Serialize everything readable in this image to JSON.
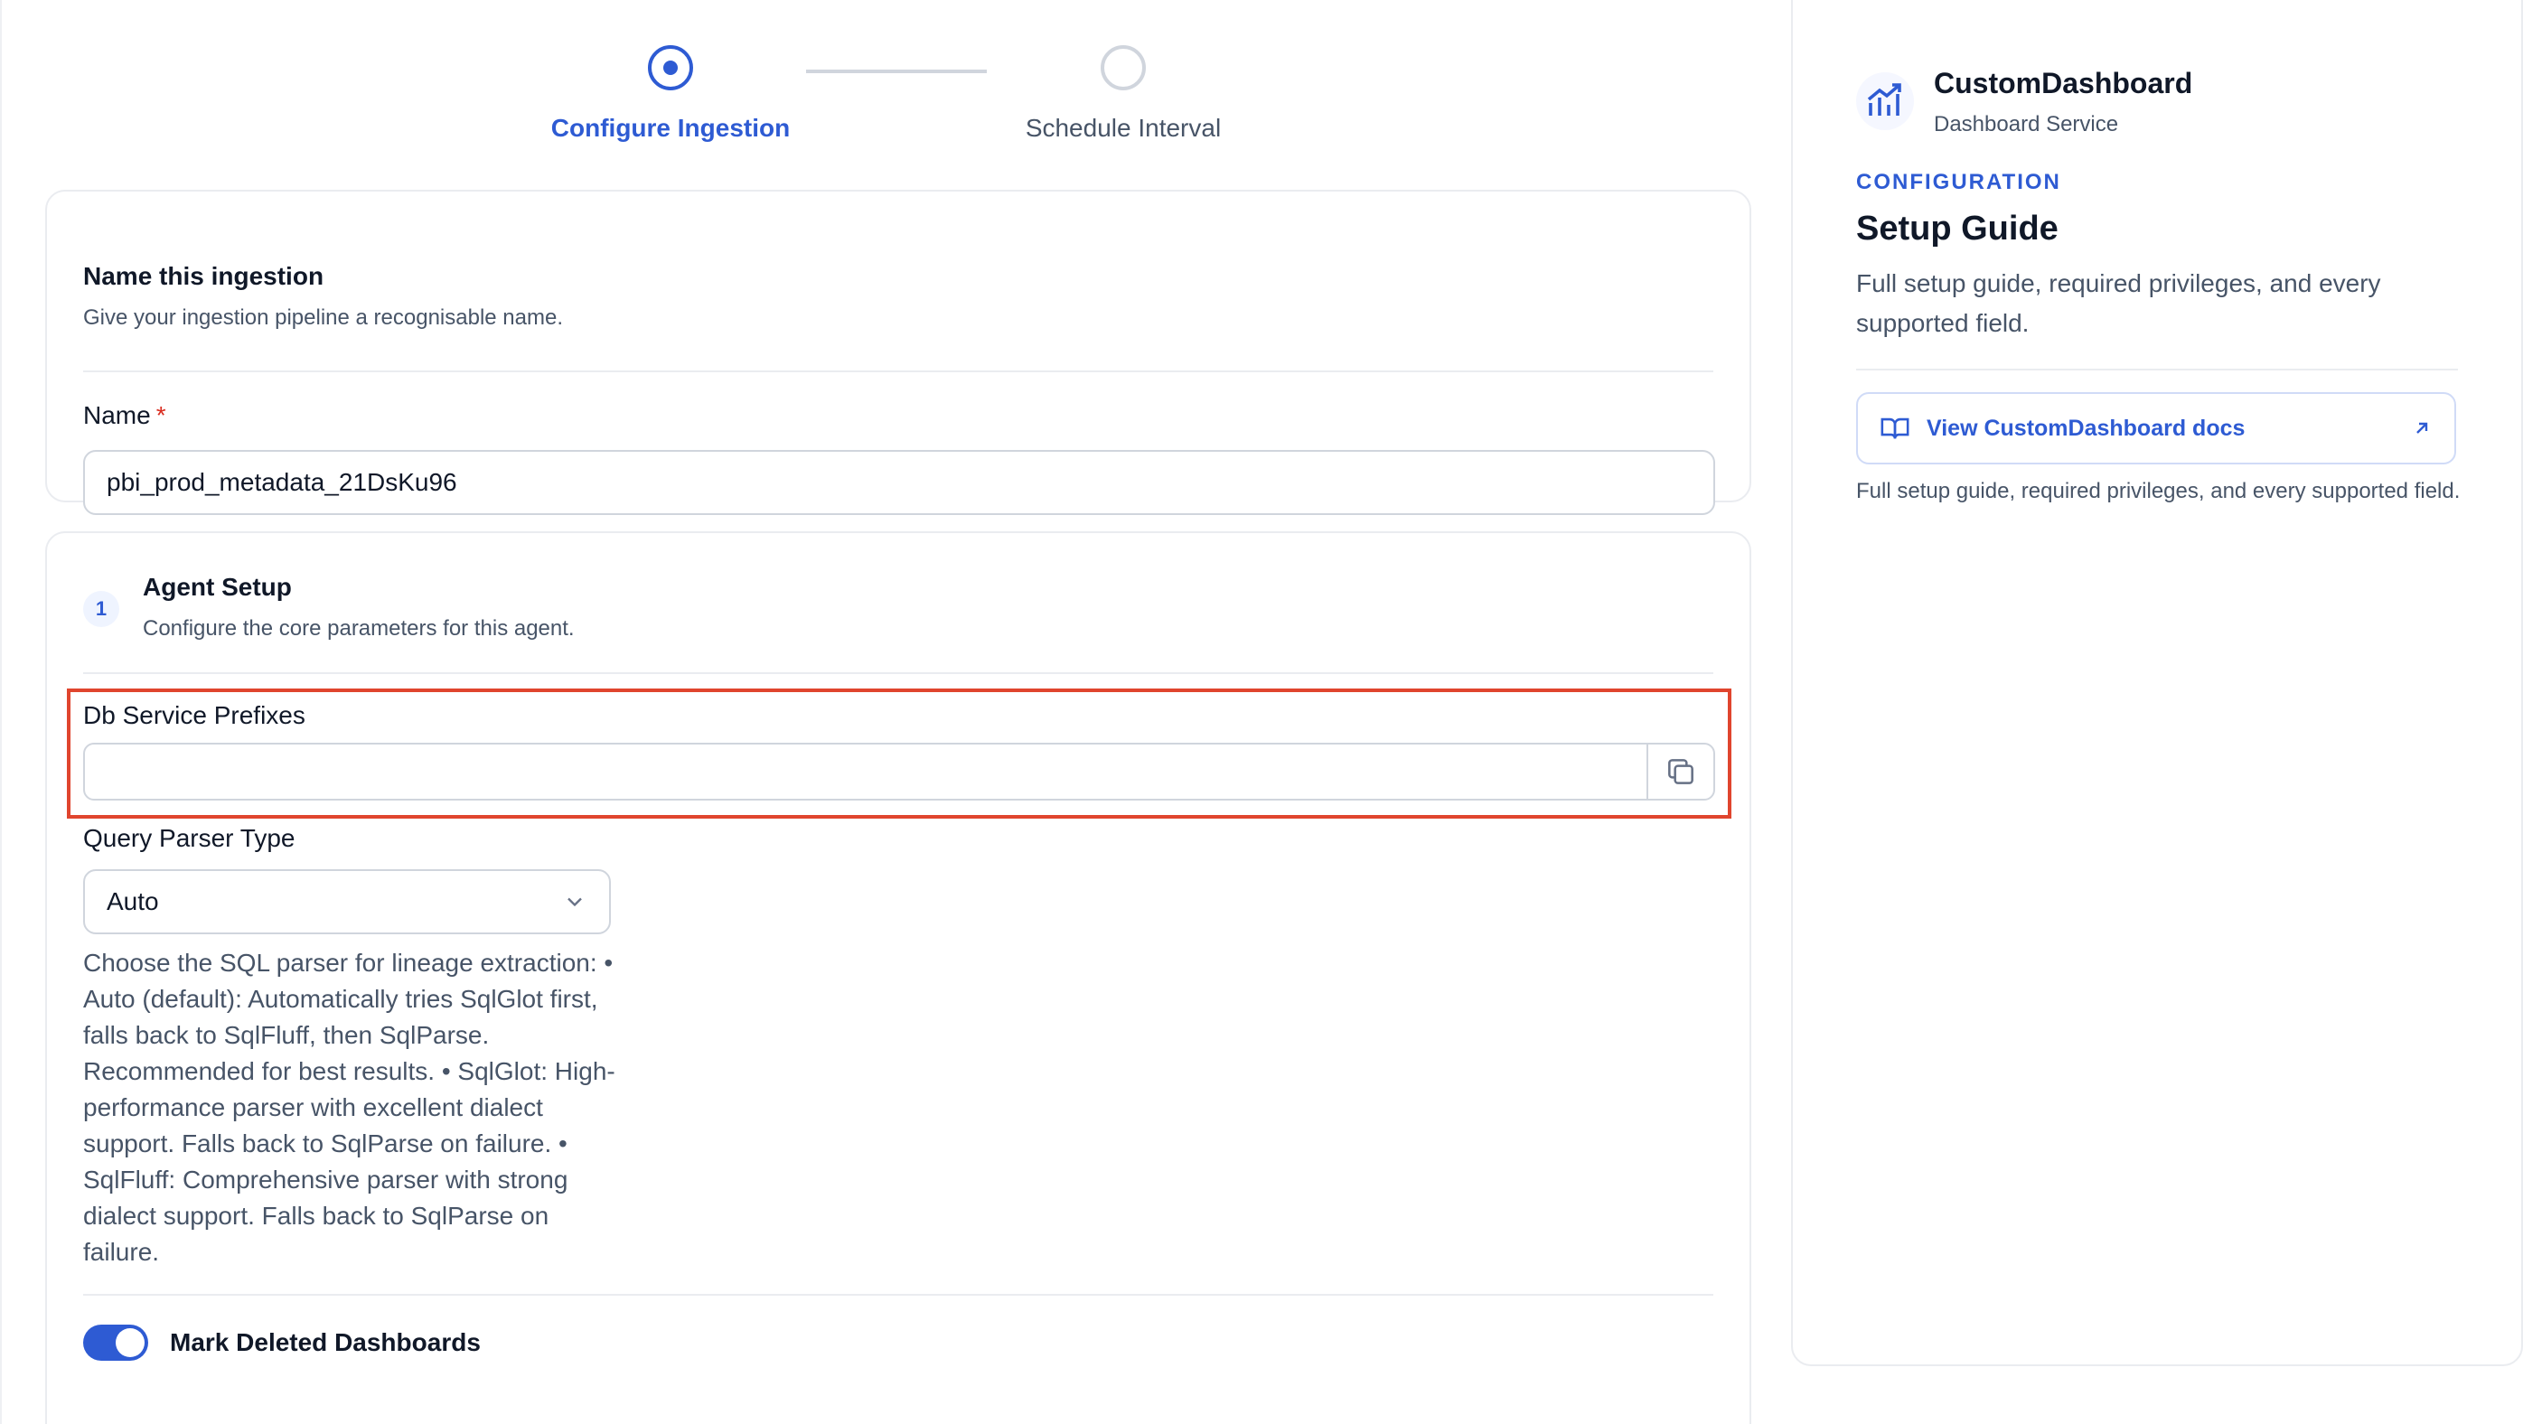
{
  "stepper": {
    "steps": [
      {
        "label": "Configure Ingestion",
        "state": "active"
      },
      {
        "label": "Schedule Interval",
        "state": "pending"
      }
    ]
  },
  "name_card": {
    "title": "Name this ingestion",
    "subtitle": "Give your ingestion pipeline a recognisable name.",
    "field_label": "Name",
    "required_mark": "*",
    "field_value": "pbi_prod_metadata_21DsKu96"
  },
  "agent_card": {
    "step_number": "1",
    "title": "Agent Setup",
    "subtitle": "Configure the core parameters for this agent.",
    "db_prefixes": {
      "label": "Db Service Prefixes",
      "value": ""
    },
    "query_parser": {
      "label": "Query Parser Type",
      "selected": "Auto",
      "help": "Choose the SQL parser for lineage extraction: • Auto (default): Automatically tries SqlGlot first, falls back to SqlFluff, then SqlParse. Recommended for best results. • SqlGlot: High-performance parser with excellent dialect support. Falls back to SqlParse on failure. • SqlFluff: Comprehensive parser with strong dialect support. Falls back to SqlParse on failure."
    },
    "mark_deleted": {
      "label": "Mark Deleted Dashboards",
      "enabled": true
    }
  },
  "panel": {
    "service_name": "CustomDashboard",
    "service_type": "Dashboard Service",
    "overline": "CONFIGURATION",
    "heading": "Setup Guide",
    "description": "Full setup guide, required privileges, and every supported field.",
    "docs_link_label": "View CustomDashboard docs",
    "note": "Full setup guide, required privileges, and every supported field."
  },
  "colors": {
    "accent": "#2e5bd3",
    "highlight": "#e0452e",
    "required": "#d92d20"
  },
  "icons": {
    "logo": "chart-growth-icon",
    "copy": "copy-icon",
    "select_caret": "chevron-down-icon",
    "docs": "book-open-icon",
    "external": "arrow-up-right-icon"
  }
}
